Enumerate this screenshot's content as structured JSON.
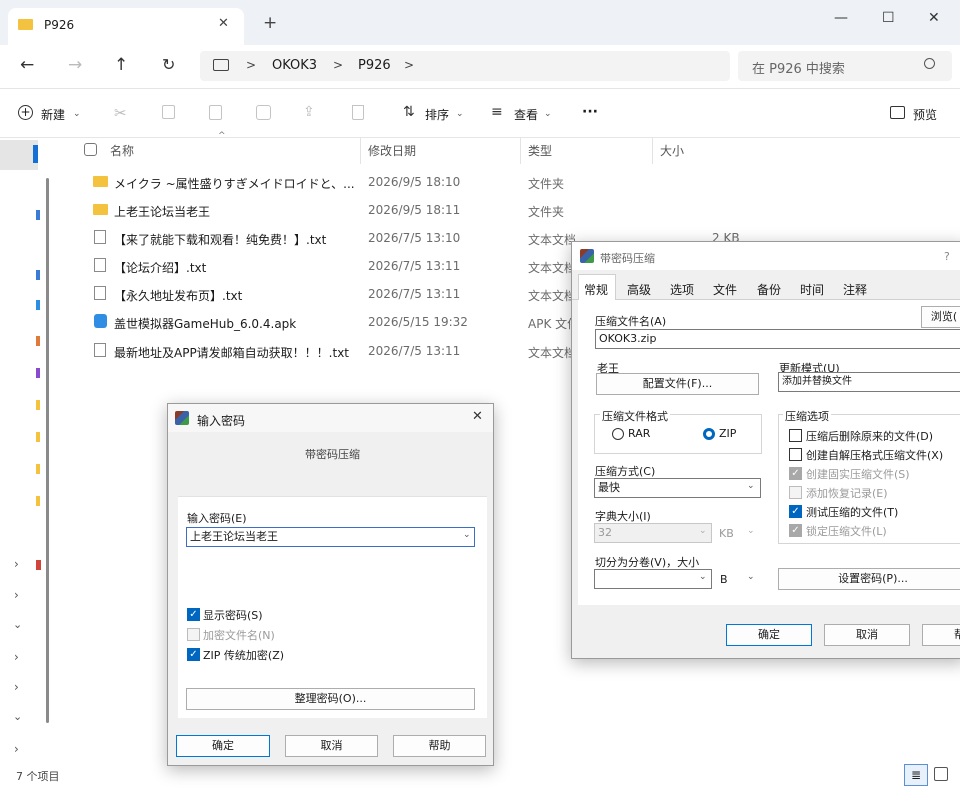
{
  "explorer": {
    "tab_title": "P926",
    "new_tab": "+",
    "win_min": "—",
    "win_max": "☐",
    "win_close": "✕",
    "breadcrumbs": [
      "OKOK3",
      "P926"
    ],
    "breadcrumb_sep": ">",
    "search_placeholder": "在 P926 中搜索",
    "toolbar": {
      "new": "新建",
      "sort": "排序",
      "view": "查看",
      "more": "···",
      "preview": "预览"
    },
    "columns": {
      "name": "名称",
      "date": "修改日期",
      "type": "类型",
      "size": "大小"
    },
    "files": [
      {
        "name": "メイクラ ~属性盛りすぎメイドロイドと、...",
        "date": "2026/9/5 18:10",
        "type": "文件夹",
        "size": "",
        "icon": "folder-icon"
      },
      {
        "name": "上老王论坛当老王",
        "date": "2026/9/5 18:11",
        "type": "文件夹",
        "size": "",
        "icon": "folder-icon"
      },
      {
        "name": "【来了就能下载和观看！纯免费！】.txt",
        "date": "2026/7/5 13:10",
        "type": "文本文档",
        "size": "2 KB",
        "icon": "text-file-icon"
      },
      {
        "name": "【论坛介绍】.txt",
        "date": "2026/7/5 13:11",
        "type": "文本文档",
        "size": "",
        "icon": "text-file-icon"
      },
      {
        "name": "【永久地址发布页】.txt",
        "date": "2026/7/5 13:11",
        "type": "文本文档",
        "size": "",
        "icon": "text-file-icon"
      },
      {
        "name": "盖世模拟器GameHub_6.0.4.apk",
        "date": "2026/5/15 19:32",
        "type": "APK 文件",
        "size": "",
        "icon": "apk-file-icon"
      },
      {
        "name": "最新地址及APP请发邮箱自动获取！！！.txt",
        "date": "2026/7/5 13:11",
        "type": "文本文档",
        "size": "",
        "icon": "text-file-icon"
      }
    ],
    "status": "7 个项目"
  },
  "archive_dialog": {
    "title": "带密码压缩",
    "help": "?",
    "tabs": [
      "常规",
      "高级",
      "选项",
      "文件",
      "备份",
      "时间",
      "注释"
    ],
    "archive_name_label": "压缩文件名(A)",
    "archive_name_value": "OKOK3.zip",
    "browse": "浏览(",
    "profile_label": "老王",
    "profile_button": "配置文件(F)...",
    "update_mode_label": "更新模式(U)",
    "update_mode_value": "添加并替换文件",
    "format_label": "压缩文件格式",
    "format_rar": "RAR",
    "format_zip": "ZIP",
    "method_label": "压缩方式(C)",
    "method_value": "最快",
    "dict_label": "字典大小(I)",
    "dict_value": "32",
    "dict_unit": "KB",
    "split_label": "切分为分卷(V)，大小",
    "split_unit": "B",
    "options_label": "压缩选项",
    "options": [
      {
        "label": "压缩后删除原来的文件(D)",
        "checked": false,
        "disabled": false
      },
      {
        "label": "创建自解压格式压缩文件(X)",
        "checked": false,
        "disabled": false
      },
      {
        "label": "创建固实压缩文件(S)",
        "checked": true,
        "disabled": true
      },
      {
        "label": "添加恢复记录(E)",
        "checked": false,
        "disabled": true
      },
      {
        "label": "测试压缩的文件(T)",
        "checked": true,
        "disabled": false
      },
      {
        "label": "锁定压缩文件(L)",
        "checked": true,
        "disabled": true
      }
    ],
    "set_password": "设置密码(P)...",
    "ok": "确定",
    "cancel": "取消",
    "help_btn": "帮"
  },
  "password_dialog": {
    "title": "输入密码",
    "subtitle": "带密码压缩",
    "input_label": "输入密码(E)",
    "input_value": "上老王论坛当老王",
    "show_password": "显示密码(S)",
    "encrypt_names": "加密文件名(N)",
    "zip_legacy": "ZIP 传统加密(Z)",
    "organize": "整理密码(O)...",
    "ok": "确定",
    "cancel": "取消",
    "help": "帮助"
  }
}
